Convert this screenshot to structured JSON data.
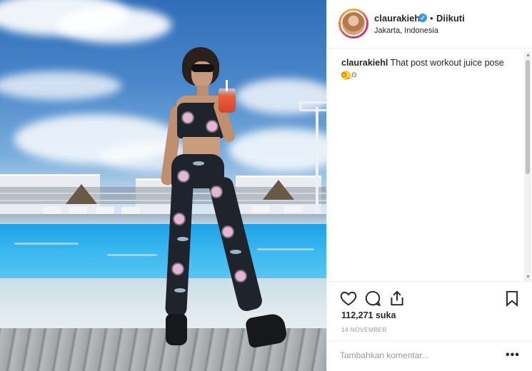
{
  "post": {
    "username": "claurakiehl",
    "verified_icon": "verified-badge-icon",
    "separator": "•",
    "follow_status": "Diikuti",
    "location": "Jakarta, Indonesia",
    "caption_user": "claurakiehl",
    "caption_text": "That post workout juice pose",
    "caption_emoji": "😂",
    "likes": "112,271 suka",
    "date": "14 NOVEMBER"
  },
  "actions": {
    "like_icon": "heart-icon",
    "comment_icon": "comment-bubble-icon",
    "share_icon": "share-icon",
    "save_icon": "bookmark-icon"
  },
  "comment_box": {
    "placeholder": "Tambahkan komentar...",
    "more_label": "•••"
  },
  "colors": {
    "accent": "#3897f0",
    "text": "#262626",
    "muted": "#999999"
  }
}
